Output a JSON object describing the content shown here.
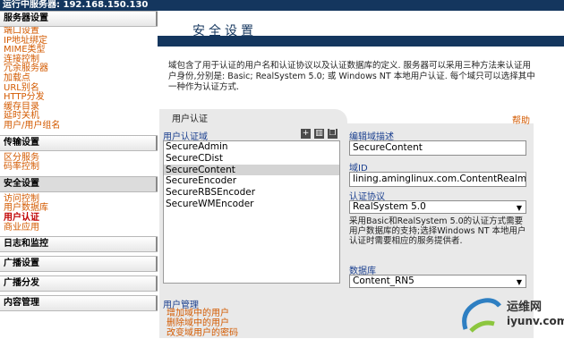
{
  "topbar": {
    "text": "运行中服务器: 192.168.150.130"
  },
  "sidebar": {
    "section_server": "服务器设置",
    "server_links": [
      "端口设置",
      "IP地址绑定",
      "MIME类型",
      "连接控制",
      "冗余服务器",
      "加载点",
      "URL别名",
      "HTTP分发",
      "缓存目录",
      "延时关机",
      "用户/用户组名"
    ],
    "section_transport": "传输设置",
    "transport_links": [
      "区分服务",
      "码率控制"
    ],
    "section_security": "安全设置",
    "security_links": [
      "访问控制",
      "用户数据库",
      "用户认证",
      "商业应用"
    ],
    "current_link": "用户认证",
    "section_log": "日志和监控",
    "section_broadcast_set": "广播设置",
    "section_broadcast_dist": "广播分发",
    "section_content": "内容管理"
  },
  "page": {
    "title": "安全设置",
    "description": "域包含了用于认证的用户名和认证协议以及认证数据库的定义. 服务器可以采用三种方法来认证用户身份,分别是: Basic; RealSystem 5.0; 或 Windows NT 本地用户认证. 每个域只可以选择其中一种作为认证方式.",
    "panel_tab": "用户认证",
    "help": "帮助"
  },
  "realm_list": {
    "label": "用户认证域",
    "items": [
      "SecureAdmin",
      "SecureCDist",
      "SecureContent",
      "SecureEncoder",
      "SecureRBSEncoder",
      "SecureWMEncoder"
    ],
    "selected": "SecureContent"
  },
  "form": {
    "desc_label": "编辑域描述",
    "desc_value": "SecureContent",
    "realm_id_label": "域ID",
    "realm_id_value": "lining.aminglinux.com.ContentRealm",
    "protocol_label": "认证协议",
    "protocol_value": "RealSystem 5.0",
    "protocol_help": "采用Basic和RealSystem 5.0的认证方式需要用户数据库的支持;选择Windows NT 本地用户认证时需要相应的服务提供者.",
    "db_label": "数据库",
    "db_value": "Content_RN5"
  },
  "user_mgmt": {
    "label": "用户管理",
    "links": [
      "增加域中的用户",
      "删除域中的用户",
      "改变域用户的密码"
    ]
  },
  "watermark": {
    "line1": "运维网",
    "line2": "iyunv.com"
  },
  "colors": {
    "nav_bar": "#14365e",
    "link": "#d35a00",
    "label": "#1a3f8f"
  }
}
